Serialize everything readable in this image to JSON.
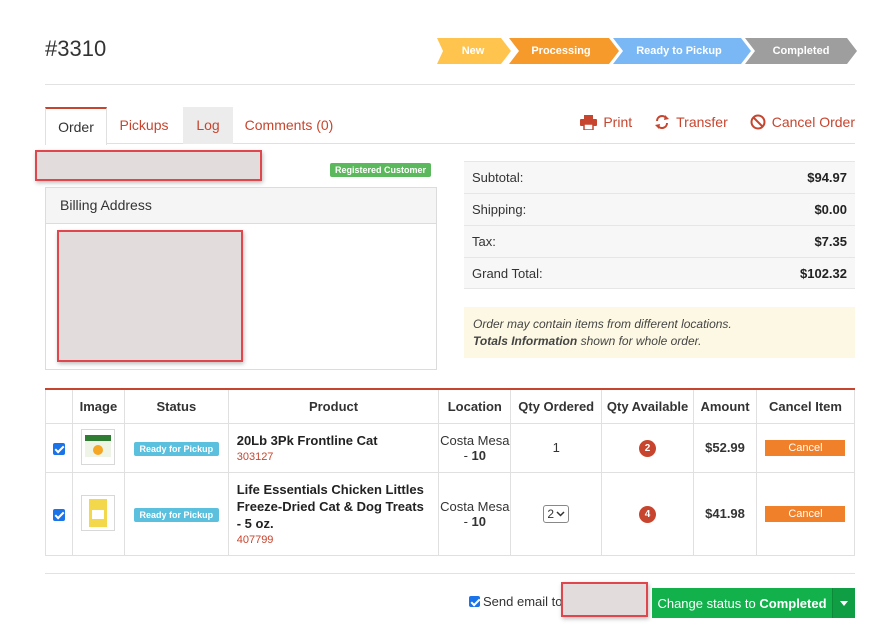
{
  "order": {
    "id": "#3310"
  },
  "steps": [
    {
      "label": "New",
      "color": "#ffc44d"
    },
    {
      "label": "Processing",
      "color": "#f59a2b"
    },
    {
      "label": "Ready to Pickup",
      "color": "#7ab8f5"
    },
    {
      "label": "Completed",
      "color": "#9e9e9e"
    }
  ],
  "tabs": [
    {
      "label": "Order"
    },
    {
      "label": "Pickups"
    },
    {
      "label": "Log"
    },
    {
      "label": "Comments (0)"
    }
  ],
  "actions": {
    "print": "Print",
    "transfer": "Transfer",
    "cancel_order": "Cancel Order"
  },
  "customer": {
    "badge": "Registered Customer"
  },
  "billing": {
    "heading": "Billing Address"
  },
  "totals": {
    "subtotal_label": "Subtotal:",
    "subtotal": "$94.97",
    "shipping_label": "Shipping:",
    "shipping": "$0.00",
    "tax_label": "Tax:",
    "tax": "$7.35",
    "grand_label": "Grand Total:",
    "grand": "$102.32"
  },
  "note": {
    "line1": "Order may contain items from different locations.",
    "bold": "Totals Information",
    "line2": " shown for whole order."
  },
  "table": {
    "headers": [
      "",
      "Image",
      "Status",
      "Product",
      "Location",
      "Qty Ordered",
      "Qty Available",
      "Amount",
      "Cancel Item"
    ],
    "rows": [
      {
        "checked": true,
        "status": "Ready for Pickup",
        "product": "20Lb 3Pk Frontline Cat",
        "sku": "303127",
        "location": "Costa Mesa",
        "location_num": "10",
        "qty_ordered": "1",
        "qty_available": "2",
        "amount": "$52.99",
        "cancel": "Cancel"
      },
      {
        "checked": true,
        "status": "Ready for Pickup",
        "product": "Life Essentials Chicken Littles Freeze-Dried Cat & Dog Treats - 5 oz.",
        "sku": "407799",
        "location": "Costa Mesa",
        "location_num": "10",
        "qty_ordered": "2",
        "qty_available": "4",
        "amount": "$41.98",
        "cancel": "Cancel"
      }
    ]
  },
  "footer": {
    "send_email": "Send email to",
    "status_prefix": "Change status to ",
    "status_target": "Completed"
  },
  "colors": {
    "accent": "#c7452e",
    "success": "#12b14c",
    "info": "#5bc0de",
    "cancel": "#f0802a"
  }
}
